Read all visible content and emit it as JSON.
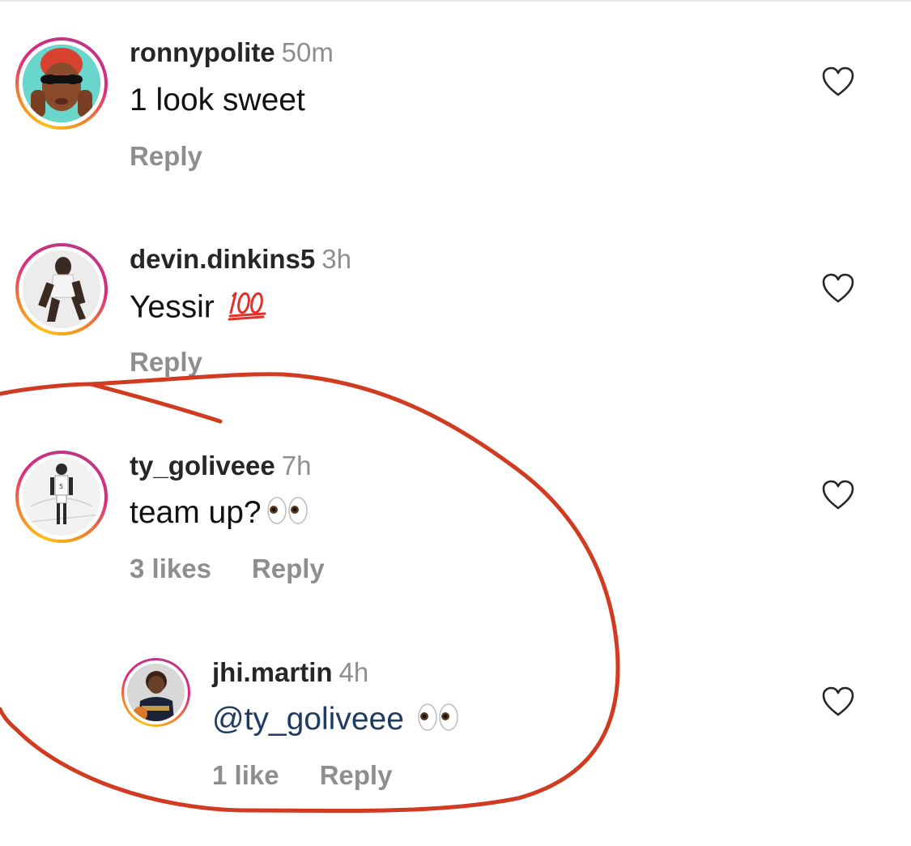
{
  "comments": [
    {
      "username": "ronnypolite",
      "time": "50m",
      "text": "1 look sweet",
      "reply_label": "Reply",
      "avatar_icon": "avatar-ronnypolite"
    },
    {
      "username": "devin.dinkins5",
      "time": "3h",
      "text": "Yessir",
      "emoji": "hundred-points-emoji",
      "reply_label": "Reply",
      "avatar_icon": "avatar-devin"
    },
    {
      "username": "ty_goliveee",
      "time": "7h",
      "text": "team up?",
      "emoji": "eyes-emoji",
      "likes_label": "3 likes",
      "reply_label": "Reply",
      "avatar_icon": "avatar-ty"
    },
    {
      "username": "jhi.martin",
      "time": "4h",
      "mention": "@ty_goliveee",
      "emoji": "eyes-emoji",
      "likes_label": "1 like",
      "reply_label": "Reply",
      "avatar_icon": "avatar-jhi"
    }
  ],
  "colors": {
    "annotation_stroke": "#d03b22",
    "mention": "#1f3b62",
    "muted": "#8e8e8e"
  }
}
